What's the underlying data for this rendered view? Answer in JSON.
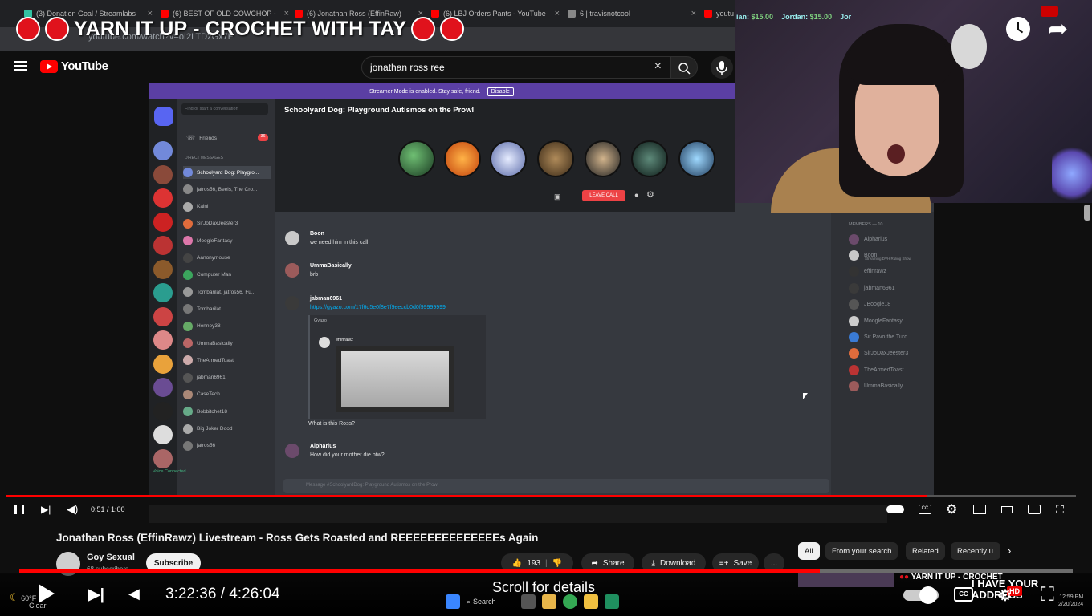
{
  "browser": {
    "tabs": [
      {
        "label": "(3) Donation Goal / Streamlabs",
        "color": "#31c3a2"
      },
      {
        "label": "(6) BEST OF OLD COWCHOP -",
        "color": "#ff0000"
      },
      {
        "label": "(6) Jonathan Ross (EffinRaw)",
        "color": "#ff0000"
      },
      {
        "label": "(6) LBJ Orders Pants - YouTube",
        "color": "#ff0000"
      },
      {
        "label": "6 | travisnotcool",
        "color": "#888888"
      },
      {
        "label": "youtu",
        "color": "#ff0000"
      }
    ],
    "url": "youtube.com/watch?v=oI2LTDzGx7E"
  },
  "overlay": {
    "title": "YARN IT UP - CROCHET WITH TAY"
  },
  "tip_ticker": {
    "entries": [
      {
        "name": "ian:",
        "amount": "$15.00"
      },
      {
        "name": "Jordan:",
        "amount": "$15.00"
      },
      {
        "name": "Jor",
        "amount": ""
      }
    ]
  },
  "youtube": {
    "logo_text": "YouTube",
    "search_value": "jonathan ross ree",
    "icons": {
      "menu": "hamburger-icon",
      "clear": "close-icon",
      "search": "search-icon",
      "mic": "mic-icon"
    }
  },
  "discord": {
    "streamer_banner": "Streamer Mode is enabled. Stay safe, friend.",
    "disable_label": "Disable",
    "search_placeholder": "Find or start a conversation",
    "friends_label": "Friends",
    "friends_badge": "36",
    "dm_header": "DIRECT MESSAGES",
    "channel_title": "Schoolyard Dog: Playground Autismos on the Prowl",
    "leave_call": "LEAVE CALL",
    "dms": [
      "Schoolyard Dog: Playgro...",
      "jatros56, Beeis, The Cro...",
      "Kaini",
      "SirJoDaxJeester3",
      "MoogleFantasy",
      "Aanonymouse",
      "Computer Man",
      "Tombarilat, jatros56, Fu...",
      "Tombarilat",
      "Henney38",
      "UmmaBasically",
      "TheArmedToast",
      "jabman6961",
      "CaseTech",
      "Bobbitchet18",
      "Big Joker Dood",
      "jatros56"
    ],
    "voice_connected": "Voice Connected",
    "messages": [
      {
        "user": "Boon",
        "text": "we need him in this call"
      },
      {
        "user": "UmmaBasically",
        "text": "brb"
      },
      {
        "user": "jabman6961",
        "text": "https://gyazo.com/17f6d5e0f8e7f9eeccb0d0f99999999"
      },
      {
        "user": "Alpharius",
        "text": "How did your mother die btw?"
      }
    ],
    "embed_site": "Gyazo",
    "embed_user": "effinrawz",
    "embed_caption": "What is this Ross?",
    "chat_placeholder": "Message #SchoolyardDog: Playground Autismos on the Prowl",
    "members_header": "MEMBERS — 10",
    "members": [
      "Alpharius",
      "Boon",
      "effinrawz",
      "jabman6961",
      "JBoogle18",
      "MoogleFantasy",
      "Sir Pavo the Turd",
      "SirJoDaxJeester3",
      "TheArmedToast",
      "UmmaBasically"
    ],
    "boon_status": "Streaming DVH Ruling Show"
  },
  "player": {
    "time_small": "0:51 / 1:00",
    "progress_fraction": 0.86,
    "icons": [
      "pause-icon",
      "next-icon",
      "volume-icon",
      "subtitles-icon",
      "settings-icon",
      "miniplayer-icon",
      "theater-icon",
      "cast-icon",
      "fullscreen-icon"
    ]
  },
  "video": {
    "title": "Jonathan Ross (EffinRawz) Livestream - Ross Gets Roasted and REEEEEEEEEEEEEEs Again",
    "channel": "Goy Sexual",
    "subscribers": "68 subscribers",
    "subscribe_label": "Subscribe",
    "likes": "193",
    "share_label": "Share",
    "download_label": "Download",
    "save_label": "Save",
    "more_label": "..."
  },
  "chips": [
    "All",
    "From your search",
    "Related",
    "Recently u"
  ],
  "outer_player": {
    "time": "3:22:36 / 4:26:04",
    "progress_fraction": 0.76,
    "scroll_details": "Scroll for details",
    "mini_title": "YARN IT UP - CROCHET",
    "have_your": "I HAVE YOUR",
    "address": "ADDRESS",
    "hd_badge": "HD"
  },
  "system": {
    "weather_temp": "60°F",
    "weather_desc": "Clear",
    "search_label": "Search",
    "time": "12:59 PM",
    "date": "2/20/2024"
  }
}
